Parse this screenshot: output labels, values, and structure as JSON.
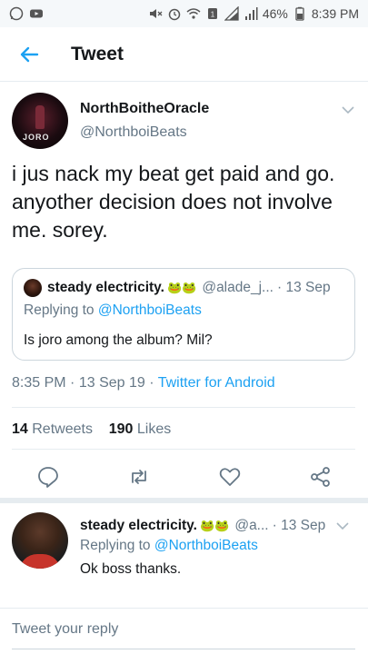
{
  "status_bar": {
    "battery": "46%",
    "time": "8:39 PM"
  },
  "header": {
    "title": "Tweet"
  },
  "tweet": {
    "display_name": "NorthBoitheOracle",
    "handle": "@NorthboiBeats",
    "avatar_text": "JORO",
    "text": "i jus nack my beat get paid and go. anyother decision does not involve me. sorey.",
    "quoted": {
      "name": "steady electricity.",
      "emoji": "🐸🐸",
      "handle": "@alade_j...",
      "date": "· 13 Sep",
      "replying_prefix": "Replying to",
      "replying_to": "@NorthboiBeats",
      "text": "Is joro among the album? Mil?"
    },
    "time": "8:35 PM",
    "date": "· 13 Sep 19 ·",
    "source": "Twitter for Android",
    "retweets_count": "14",
    "retweets_label": "Retweets",
    "likes_count": "190",
    "likes_label": "Likes"
  },
  "reply": {
    "name": "steady electricity.",
    "emoji": "🐸🐸",
    "handle": "@a...",
    "date": "· 13 Sep",
    "replying_prefix": "Replying to",
    "replying_to": "@NorthboiBeats",
    "text": "Ok boss thanks."
  },
  "composer": {
    "placeholder": "Tweet your reply"
  },
  "colors": {
    "accent": "#1da1f2",
    "text": "#14171a",
    "secondary": "#657786"
  }
}
